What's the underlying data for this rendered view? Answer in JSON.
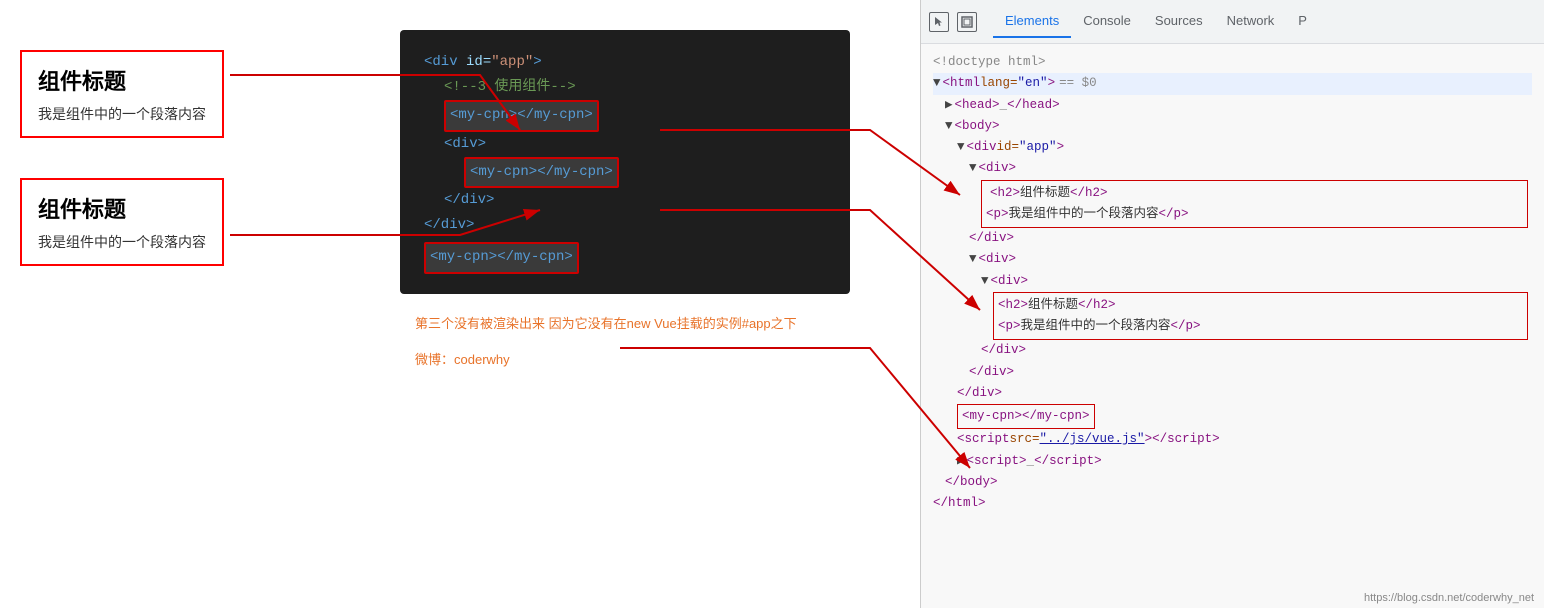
{
  "left_panel": {
    "component1": {
      "title": "组件标题",
      "desc": "我是组件中的一个段落内容"
    },
    "component2": {
      "title": "组件标题",
      "desc": "我是组件中的一个段落内容"
    }
  },
  "code_panel": {
    "lines": [
      "<div id=\"app\">",
      "<!--3.使用组件-->",
      "<my-cpn></my-cpn>",
      "<div>",
      "<my-cpn></my-cpn>",
      "</div>",
      "</div>",
      "<my-cpn></my-cpn>"
    ],
    "annotation": "第三个没有被渲染出来\n因为它没有在new Vue挂载的实例#app之下",
    "weibo": "微博：coderwhy"
  },
  "devtools": {
    "icons": [
      "cursor",
      "box"
    ],
    "tabs": [
      "Elements",
      "Console",
      "Sources",
      "Network",
      "P"
    ],
    "active_tab": "Elements",
    "content_lines": [
      "<!doctype html>",
      "<html lang=\"en\"> == $0",
      "<head>_</head>",
      "<body>",
      "<div id=\"app\">",
      "<div>",
      "<h2>组件标题</h2>",
      "<p>我是组件中的一个段落内容</p>",
      "</div>",
      "<div>",
      "<div>",
      "<h2>组件标题</h2>",
      "<p>我是组件中的一个段落内容</p>",
      "</div>",
      "</div>",
      "</div>",
      "<my-cpn></my-cpn>",
      "<script src=\"../js/vue.js\"></script>",
      "<script>_</script>",
      "</body>",
      "</html>"
    ]
  },
  "bottom_url": "https://blog.csdn.net/coderwhy_net"
}
